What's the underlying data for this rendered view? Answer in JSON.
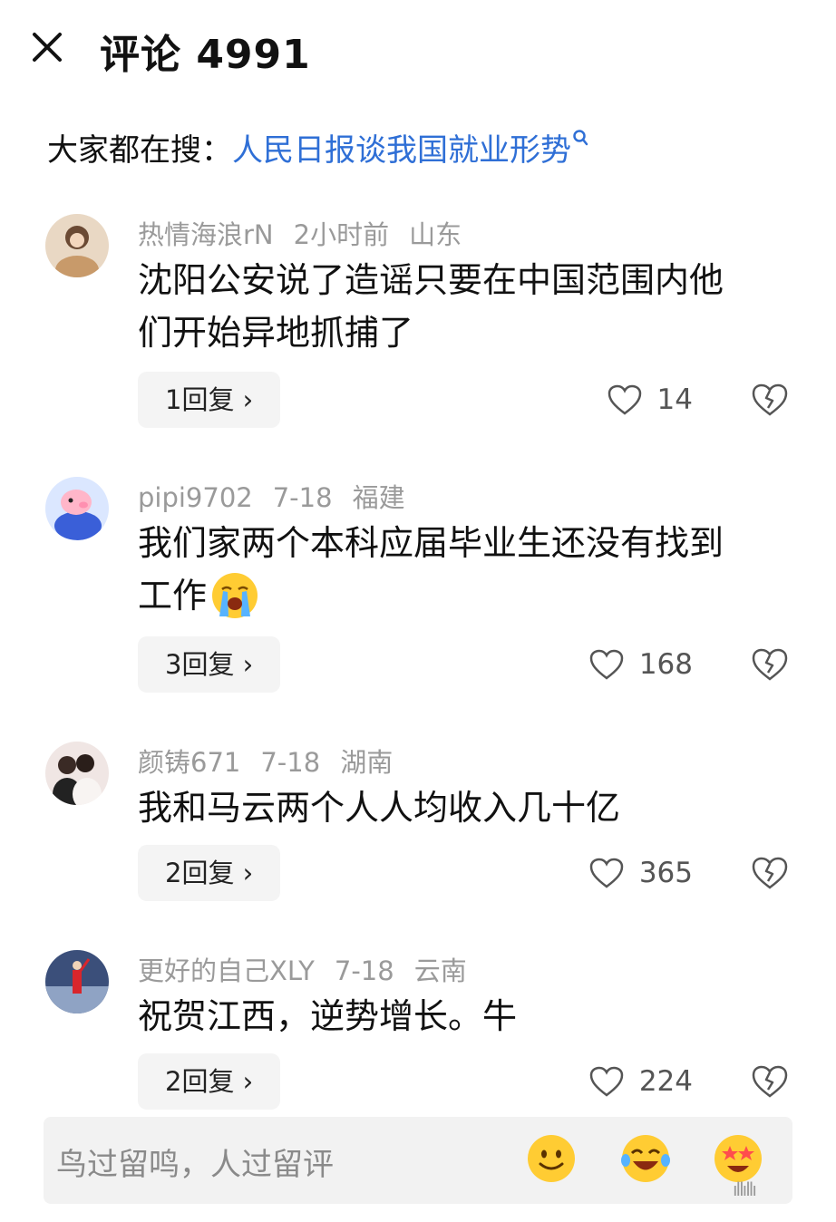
{
  "header": {
    "title": "评论 4991"
  },
  "search": {
    "prefix": "大家都在搜：",
    "query": "人民日报谈我国就业形势"
  },
  "comments": [
    {
      "user": "热情海浪rN",
      "time": "2小时前",
      "location": "山东",
      "lines": [
        "沈阳公安说了造谣只要在中国范围内他",
        "们开始异地抓捕了"
      ],
      "replies": "1回复",
      "likes": "14"
    },
    {
      "user": "pipi9702",
      "time": "7-18",
      "location": "福建",
      "lines": [
        "我们家两个本科应届毕业生还没有找到",
        "工作"
      ],
      "emoji": "crying-face",
      "replies": "3回复",
      "likes": "168"
    },
    {
      "user": "颜铸671",
      "time": "7-18",
      "location": "湖南",
      "lines": [
        "我和马云两个人人均收入几十亿"
      ],
      "replies": "2回复",
      "likes": "365"
    },
    {
      "user": "更好的自己XLY",
      "time": "7-18",
      "location": "云南",
      "lines": [
        "祝贺江西，逆势增长。牛"
      ],
      "replies": "2回复",
      "likes": "224"
    }
  ],
  "input": {
    "placeholder": "鸟过留鸣，人过留评",
    "emojis": [
      "smile-emoji",
      "laughing-emoji",
      "star-eyes-emoji"
    ]
  },
  "colors": {
    "link": "#2f6fd6",
    "meta": "#9a9a9a",
    "reply_bg": "#f4f4f4",
    "emoji_yellow": "#ffcc33"
  }
}
